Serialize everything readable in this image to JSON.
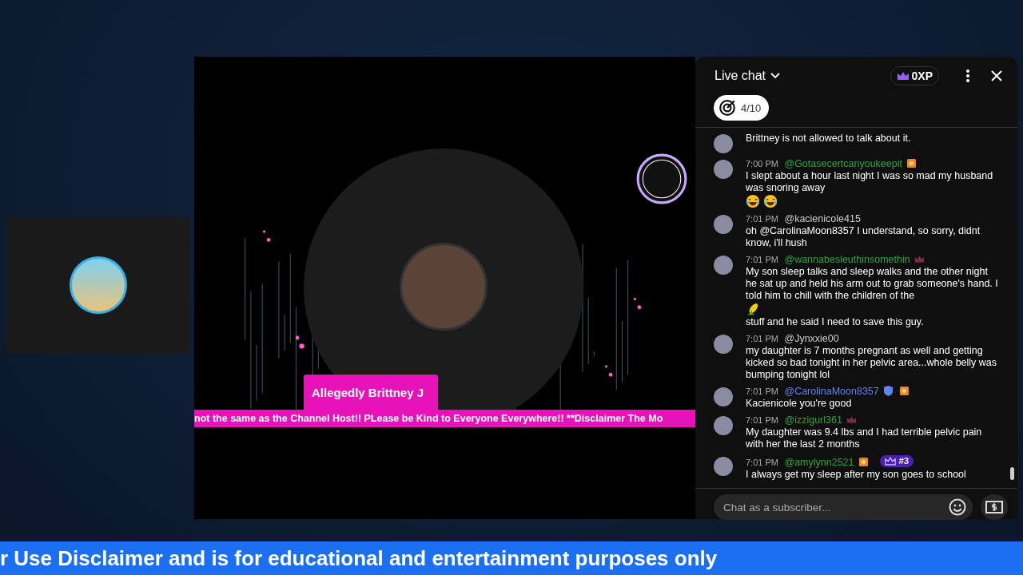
{
  "left_tile": {
    "kind": "avatar"
  },
  "stage": {
    "name_tag": "Allegedly Brittney J",
    "ticker": "not the same as the Channel Host!! PLease be Kind to Everyone Everywhere!! **Disclaimer The Mo"
  },
  "chat": {
    "title": "Live chat",
    "xp": "0XP",
    "goal": "4/10",
    "messages": [
      {
        "kind": "continuation",
        "parts": [
          {
            "kind": "text",
            "text": "Brittney is not allowed to talk about it."
          }
        ]
      },
      {
        "kind": "message",
        "time": "7:00 PM",
        "author": "@Gotasecertcanyoukeepit",
        "color": "#2ba640",
        "moderator": false,
        "member_badge": true,
        "crown_badge": false,
        "parts": [
          {
            "kind": "text",
            "text": "I slept about a hour last night I was so mad my husband was snoring away"
          },
          {
            "kind": "laugh-emoji"
          },
          {
            "kind": "laugh-emoji"
          }
        ]
      },
      {
        "kind": "message",
        "time": "7:01 PM",
        "author": "@kacienicole415",
        "color": "#cccccc",
        "moderator": false,
        "member_badge": false,
        "crown_badge": false,
        "parts": [
          {
            "kind": "text",
            "text": "oh @CarolinaMoon8357 I understand, so sorry, didnt know, i'll hush"
          }
        ]
      },
      {
        "kind": "message",
        "time": "7:01 PM",
        "author": "@wannabesleuthinsomethin",
        "color": "#2ba640",
        "moderator": false,
        "member_badge": false,
        "crown_badge": true,
        "parts": [
          {
            "kind": "text",
            "text": "My son sleep talks and sleep walks and the other night he sat up and held his arm out to grab someone's hand. I told him to chill with the children of the"
          },
          {
            "kind": "corn-emoji"
          },
          {
            "kind": "text",
            "text": "stuff and he said I need to save this guy."
          }
        ]
      },
      {
        "kind": "message",
        "time": "7:01 PM",
        "author": "@Jynxxie00",
        "color": "#cccccc",
        "moderator": false,
        "member_badge": false,
        "crown_badge": false,
        "parts": [
          {
            "kind": "text",
            "text": "my daughter is 7 months pregnant as well and getting kicked so bad tonight in her pelvic area...whole belly was bumping tonight lol"
          }
        ]
      },
      {
        "kind": "message",
        "time": "7:01 PM",
        "author": "@CarolinaMoon8357",
        "color": "#5e84f1",
        "moderator": true,
        "member_badge": true,
        "crown_badge": false,
        "parts": [
          {
            "kind": "text",
            "text": "Kacienicole you're good"
          }
        ]
      },
      {
        "kind": "message",
        "time": "7:01 PM",
        "author": "@izzigurl361",
        "color": "#2ba640",
        "moderator": false,
        "member_badge": false,
        "crown_badge": true,
        "parts": [
          {
            "kind": "text",
            "text": "My daughter was 9.4 lbs and I had terrible pelvic pain with her the last 2 months"
          }
        ]
      },
      {
        "kind": "message",
        "time": "7:01 PM",
        "author": "@amylynn2521",
        "color": "#2ba640",
        "moderator": false,
        "member_badge": true,
        "crown_badge": false,
        "rank": "#3",
        "parts": [
          {
            "kind": "text",
            "text": "I always get my sleep after my son goes to school"
          }
        ]
      }
    ],
    "input": {
      "placeholder": "Chat as a subscriber..."
    }
  },
  "banner": "r Use Disclaimer and is for educational and entertainment purposes only"
}
